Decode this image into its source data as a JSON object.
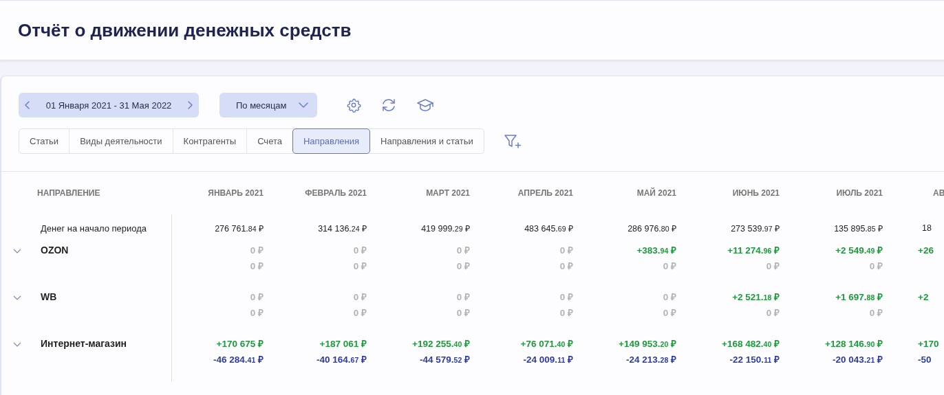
{
  "page": {
    "title": "Отчёт о движении денежных средств"
  },
  "toolbar": {
    "date_range": "01 Января 2021 - 31 Мая 2022",
    "grouping": "По месяцам"
  },
  "tabs": [
    {
      "label": "Статьи",
      "selected": false
    },
    {
      "label": "Виды деятельности",
      "selected": false
    },
    {
      "label": "Контрагенты",
      "selected": false
    },
    {
      "label": "Счета",
      "selected": false
    },
    {
      "label": "Направления",
      "selected": true
    },
    {
      "label": "Направления и статьи",
      "selected": false
    }
  ],
  "table": {
    "columns": [
      {
        "label": "НАПРАВЛЕНИЕ",
        "kind": "name"
      },
      {
        "label": "ЯНВАРЬ 2021",
        "kind": "month"
      },
      {
        "label": "ФЕВРАЛЬ 2021",
        "kind": "month"
      },
      {
        "label": "МАРТ 2021",
        "kind": "month"
      },
      {
        "label": "АПРЕЛЬ 2021",
        "kind": "month"
      },
      {
        "label": "МАЙ 2021",
        "kind": "month"
      },
      {
        "label": "ИЮНЬ 2021",
        "kind": "month"
      },
      {
        "label": "ИЮЛЬ 2021",
        "kind": "month"
      },
      {
        "label": "АВ",
        "kind": "cut"
      }
    ],
    "opening_balance": {
      "label": "Денег на начало периода",
      "values": [
        "276 761.84 ₽",
        "314 136.24 ₽",
        "419 999.29 ₽",
        "483 645.69 ₽",
        "286 976.80 ₽",
        "273 539.97 ₽",
        "135 895.85 ₽",
        "18"
      ]
    },
    "rows": [
      {
        "name": "OZON",
        "inflow": [
          {
            "text": "0 ₽",
            "kind": "zero"
          },
          {
            "text": "0 ₽",
            "kind": "zero"
          },
          {
            "text": "0 ₽",
            "kind": "zero"
          },
          {
            "text": "0 ₽",
            "kind": "zero"
          },
          {
            "text": "+383.94 ₽",
            "kind": "income"
          },
          {
            "text": "+11 274.96 ₽",
            "kind": "income"
          },
          {
            "text": "+2 549.49 ₽",
            "kind": "income"
          },
          {
            "text": "+26",
            "kind": "income"
          }
        ],
        "outflow": [
          {
            "text": "0 ₽",
            "kind": "zero"
          },
          {
            "text": "0 ₽",
            "kind": "zero"
          },
          {
            "text": "0 ₽",
            "kind": "zero"
          },
          {
            "text": "0 ₽",
            "kind": "zero"
          },
          {
            "text": "0 ₽",
            "kind": "zero"
          },
          {
            "text": "0 ₽",
            "kind": "zero"
          },
          {
            "text": "0 ₽",
            "kind": "zero"
          }
        ]
      },
      {
        "name": "WB",
        "inflow": [
          {
            "text": "0 ₽",
            "kind": "zero"
          },
          {
            "text": "0 ₽",
            "kind": "zero"
          },
          {
            "text": "0 ₽",
            "kind": "zero"
          },
          {
            "text": "0 ₽",
            "kind": "zero"
          },
          {
            "text": "0 ₽",
            "kind": "zero"
          },
          {
            "text": "+2 521.18 ₽",
            "kind": "income"
          },
          {
            "text": "+1 697.88 ₽",
            "kind": "income"
          },
          {
            "text": "+2",
            "kind": "income"
          }
        ],
        "outflow": [
          {
            "text": "0 ₽",
            "kind": "zero"
          },
          {
            "text": "0 ₽",
            "kind": "zero"
          },
          {
            "text": "0 ₽",
            "kind": "zero"
          },
          {
            "text": "0 ₽",
            "kind": "zero"
          },
          {
            "text": "0 ₽",
            "kind": "zero"
          },
          {
            "text": "0 ₽",
            "kind": "zero"
          },
          {
            "text": "0 ₽",
            "kind": "zero"
          }
        ]
      },
      {
        "name": "Интернет-магазин",
        "inflow": [
          {
            "text": "+170 675 ₽",
            "kind": "income"
          },
          {
            "text": "+187 061 ₽",
            "kind": "income"
          },
          {
            "text": "+192 255.40 ₽",
            "kind": "income"
          },
          {
            "text": "+76 071.40 ₽",
            "kind": "income"
          },
          {
            "text": "+149 953.20 ₽",
            "kind": "income"
          },
          {
            "text": "+168 482.40 ₽",
            "kind": "income"
          },
          {
            "text": "+128 146.90 ₽",
            "kind": "income"
          },
          {
            "text": "+170",
            "kind": "income"
          }
        ],
        "outflow": [
          {
            "text": "-46 284.41 ₽",
            "kind": "expense"
          },
          {
            "text": "-40 164.67 ₽",
            "kind": "expense"
          },
          {
            "text": "-44 579.52 ₽",
            "kind": "expense"
          },
          {
            "text": "-24 009.11 ₽",
            "kind": "expense"
          },
          {
            "text": "-24 213.28 ₽",
            "kind": "expense"
          },
          {
            "text": "-22 150.11 ₽",
            "kind": "expense"
          },
          {
            "text": "-20 043.21 ₽",
            "kind": "expense"
          },
          {
            "text": "-50",
            "kind": "expense"
          }
        ]
      }
    ]
  }
}
